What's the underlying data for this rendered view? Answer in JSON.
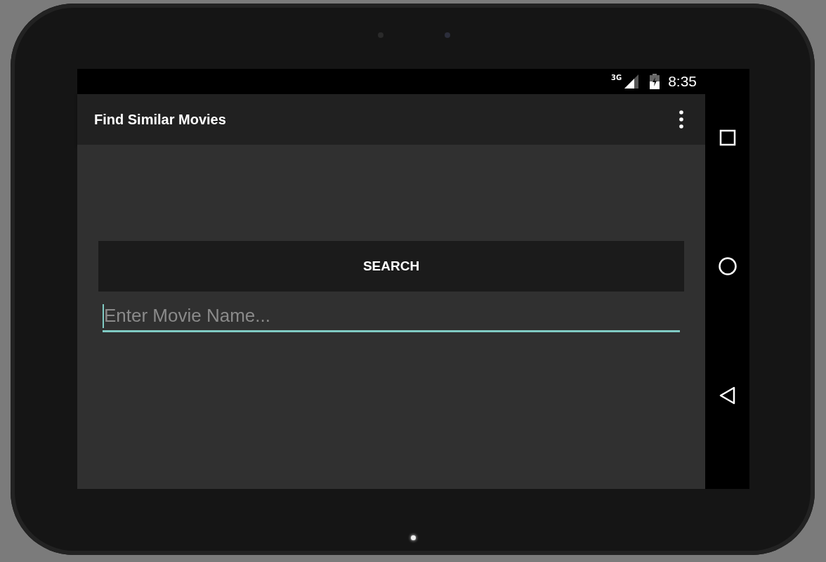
{
  "status_bar": {
    "network": "3G",
    "time": "8:35"
  },
  "app_bar": {
    "title": "Find Similar Movies"
  },
  "search_button": {
    "label": "SEARCH"
  },
  "movie_field": {
    "placeholder": "Enter Movie Name...",
    "focused": true
  },
  "nav_bar": {
    "buttons": [
      {
        "kind": "recents"
      },
      {
        "kind": "home"
      },
      {
        "kind": "back"
      }
    ]
  }
}
